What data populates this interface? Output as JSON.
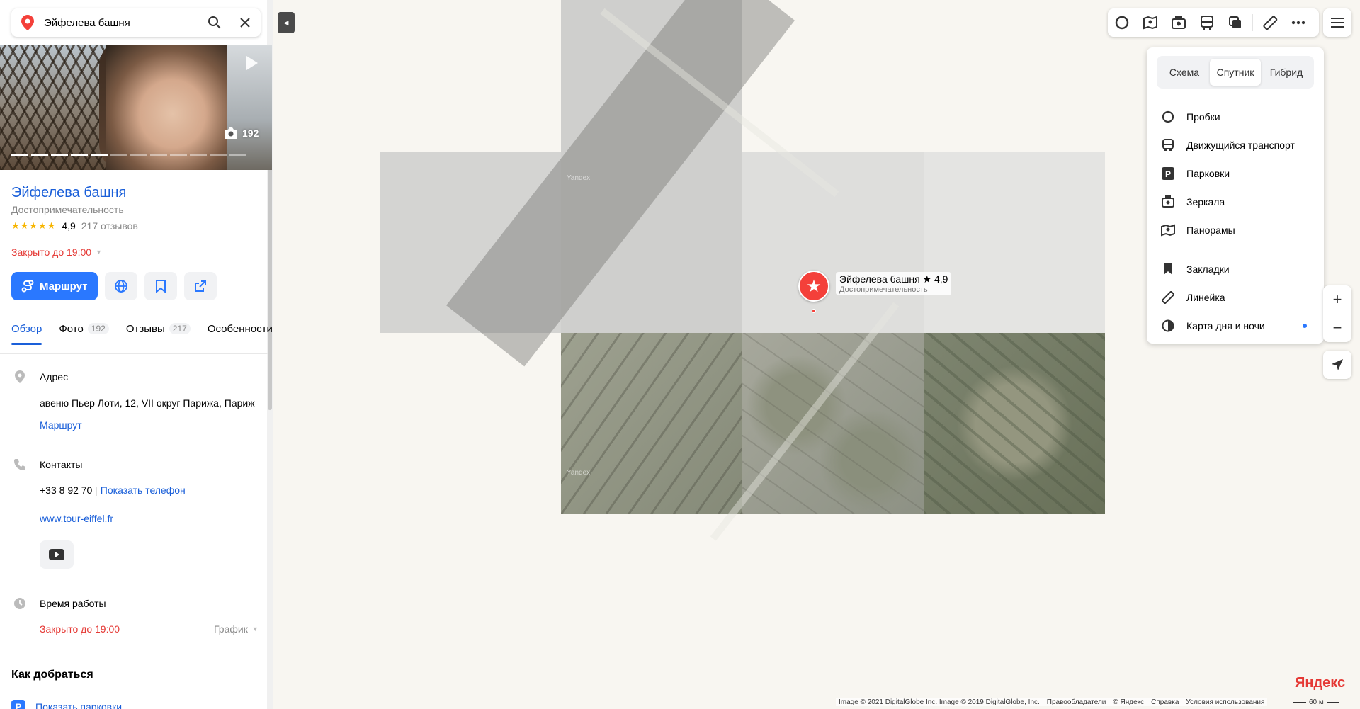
{
  "search": {
    "query": "Эйфелева башня"
  },
  "photo": {
    "count": "192"
  },
  "place": {
    "title": "Эйфелева башня",
    "category": "Достопримечательность",
    "rating": "4,9",
    "reviews": "217 отзывов",
    "status": "Закрыто до 19:00"
  },
  "actions": {
    "route_label": "Маршрут"
  },
  "tabs": [
    {
      "label": "Обзор",
      "badge": ""
    },
    {
      "label": "Фото",
      "badge": "192"
    },
    {
      "label": "Отзывы",
      "badge": "217"
    },
    {
      "label": "Особенности",
      "badge": ""
    }
  ],
  "address": {
    "label": "Адрес",
    "text": "авеню Пьер Лоти, 12, VII округ Парижа, Париж",
    "route_link": "Маршрут"
  },
  "contacts": {
    "label": "Контакты",
    "phone": "+33 8 92 70",
    "show_phone": "Показать телефон",
    "website": "www.tour-eiffel.fr"
  },
  "hours": {
    "label": "Время работы",
    "status": "Закрыто до 19:00",
    "schedule": "График"
  },
  "how_to_get": {
    "title": "Как добраться",
    "parking_link": "Показать парковки"
  },
  "map": {
    "marker_title": "Эйфелева башня ★ 4,9",
    "marker_sub": "Достопримечательность",
    "watermark": "Yandex",
    "logo": "Яндекс",
    "copyright_1": "Image © 2021 DigitalGlobe Inc. Image © 2019 DigitalGlobe, Inc.",
    "copyright_2": "Правообладатели",
    "copyright_3": "© Яндекс",
    "copyright_4": "Справка",
    "copyright_5": "Условия использования",
    "scale": "60 м"
  },
  "layers_panel": {
    "segments": [
      "Схема",
      "Спутник",
      "Гибрид"
    ],
    "active_segment": "Спутник",
    "items": [
      {
        "label": "Пробки",
        "icon": "traffic-icon"
      },
      {
        "label": "Движущийся транспорт",
        "icon": "bus-icon"
      },
      {
        "label": "Парковки",
        "icon": "parking-icon"
      },
      {
        "label": "Зеркала",
        "icon": "camera-icon"
      },
      {
        "label": "Панорамы",
        "icon": "panorama-icon"
      },
      {
        "label": "Закладки",
        "icon": "bookmark-icon"
      },
      {
        "label": "Линейка",
        "icon": "ruler-icon"
      },
      {
        "label": "Карта дня и ночи",
        "icon": "day-night-icon"
      }
    ]
  },
  "colors": {
    "accent": "#2a78ff",
    "link": "#1a5fd9",
    "closed": "#e53935",
    "marker": "#f4403a",
    "star": "#f7b500"
  }
}
